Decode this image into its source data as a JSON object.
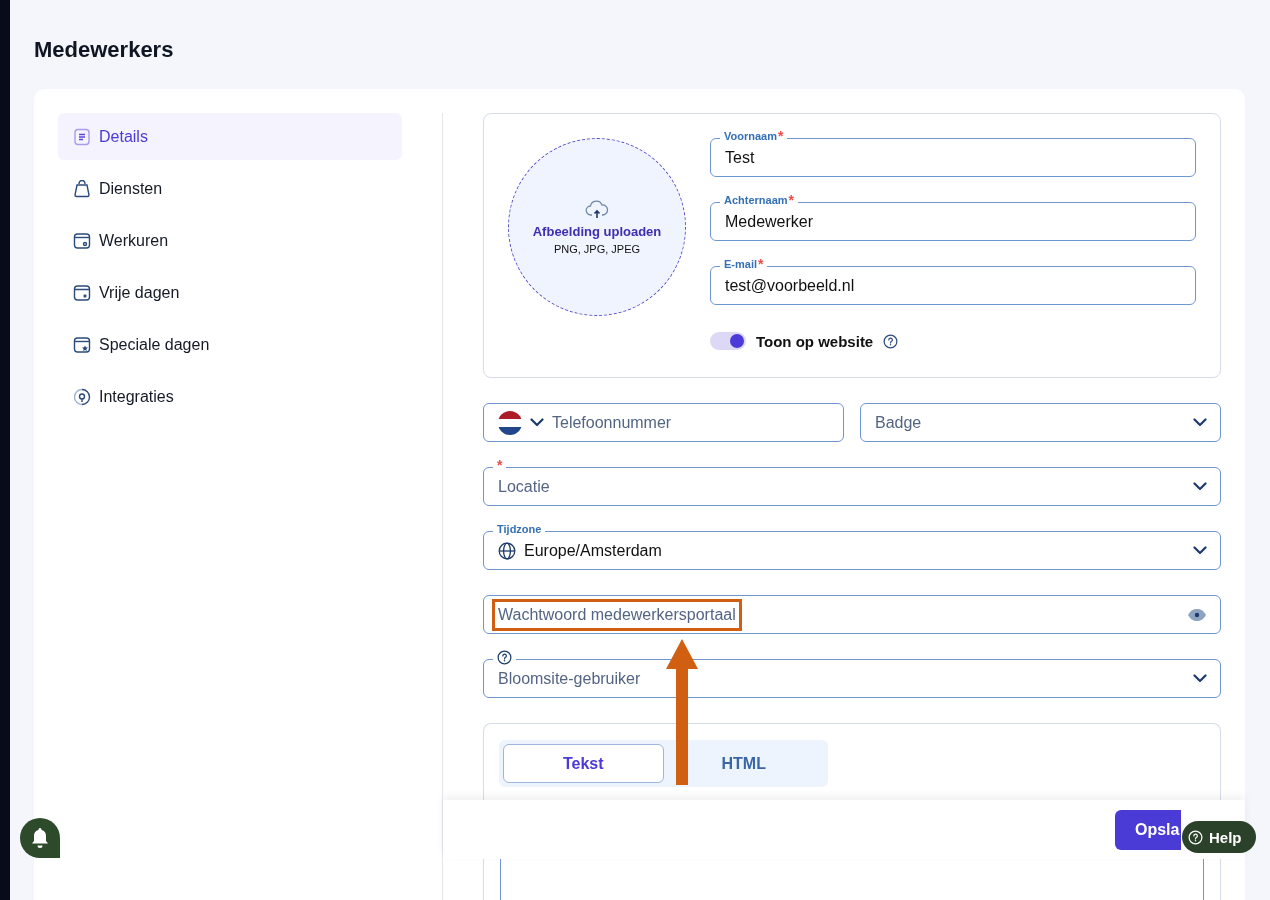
{
  "page": {
    "title": "Medewerkers"
  },
  "sidebar": {
    "items": [
      {
        "label": "Details",
        "selected": true
      },
      {
        "label": "Diensten",
        "selected": false
      },
      {
        "label": "Werkuren",
        "selected": false
      },
      {
        "label": "Vrije dagen",
        "selected": false
      },
      {
        "label": "Speciale dagen",
        "selected": false
      },
      {
        "label": "Integraties",
        "selected": false
      }
    ]
  },
  "upload": {
    "title": "Afbeelding uploaden",
    "formats": "PNG, JPG, JPEG"
  },
  "name_fields": [
    {
      "label": "Voornaam",
      "required_mark": "*",
      "value": "Test"
    },
    {
      "label": "Achternaam",
      "required_mark": "*",
      "value": "Medewerker"
    },
    {
      "label": "E-mail",
      "required_mark": "*",
      "value": "test@voorbeeld.nl"
    }
  ],
  "toggle": {
    "label": "Toon op website",
    "on": true
  },
  "phone": {
    "placeholder": "Telefoonnummer"
  },
  "badge": {
    "placeholder": "Badge"
  },
  "location": {
    "required_mark": "*",
    "placeholder": "Locatie"
  },
  "timezone": {
    "label": "Tijdzone",
    "value": "Europe/Amsterdam"
  },
  "password": {
    "placeholder": "Wachtwoord medewerkersportaal"
  },
  "bloomsite": {
    "placeholder": "Bloomsite-gebruiker"
  },
  "editor": {
    "tabs": [
      {
        "label": "Tekst",
        "selected": true
      },
      {
        "label": "HTML",
        "selected": false
      }
    ]
  },
  "save_button": {
    "label": "Opsla"
  },
  "help_button": {
    "label": "Help"
  }
}
